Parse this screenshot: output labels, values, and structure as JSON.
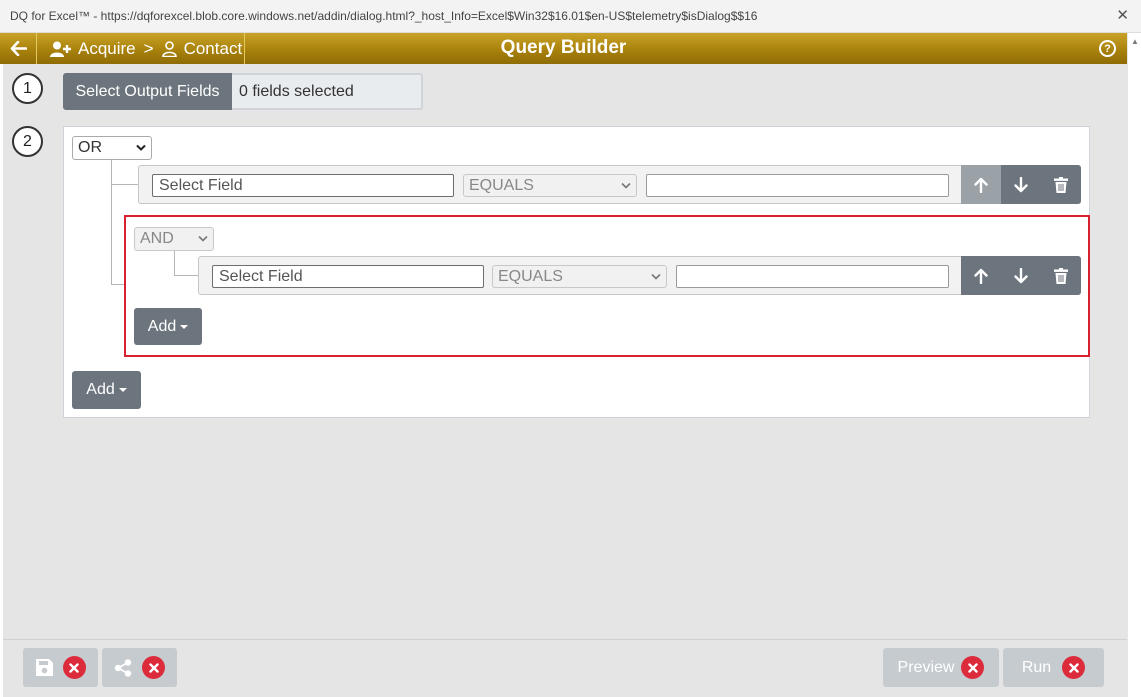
{
  "window": {
    "title": "DQ for Excel™ - https://dqforexcel.blob.core.windows.net/addin/dialog.html?_host_Info=Excel$Win32$16.01$en-US$telemetry$isDialog$$16",
    "close_glyph": "✕"
  },
  "header": {
    "title": "Query Builder",
    "breadcrumb": {
      "first": "Acquire",
      "separator": ">",
      "second": "Contact"
    },
    "help_glyph": "?",
    "color": "#a9820c"
  },
  "steps": {
    "one": "1",
    "two": "2"
  },
  "output_fields": {
    "button_label": "Select Output Fields",
    "summary": "0 fields selected"
  },
  "query": {
    "root_operator": "OR",
    "rule1": {
      "field_placeholder": "Select Field",
      "operator": "EQUALS",
      "value": ""
    },
    "group": {
      "operator": "AND",
      "rule": {
        "field_placeholder": "Select Field",
        "operator": "EQUALS",
        "value": ""
      },
      "add_label": "Add"
    },
    "add_label": "Add"
  },
  "footer": {
    "preview_label": "Preview",
    "run_label": "Run"
  },
  "icons": {
    "back": "arrow-left-icon",
    "acquire": "user-plus-icon",
    "contact": "user-icon",
    "help": "question-circle-icon",
    "move_up": "arrow-up-icon",
    "move_down": "arrow-down-icon",
    "delete": "trash-icon",
    "save": "save-icon",
    "share": "share-icon",
    "cancel": "x-circle-icon"
  },
  "colors": {
    "accent": "#a9820c",
    "highlight_border": "#d9202f",
    "danger": "#dc2b3b",
    "button_dark": "#6c757d"
  }
}
